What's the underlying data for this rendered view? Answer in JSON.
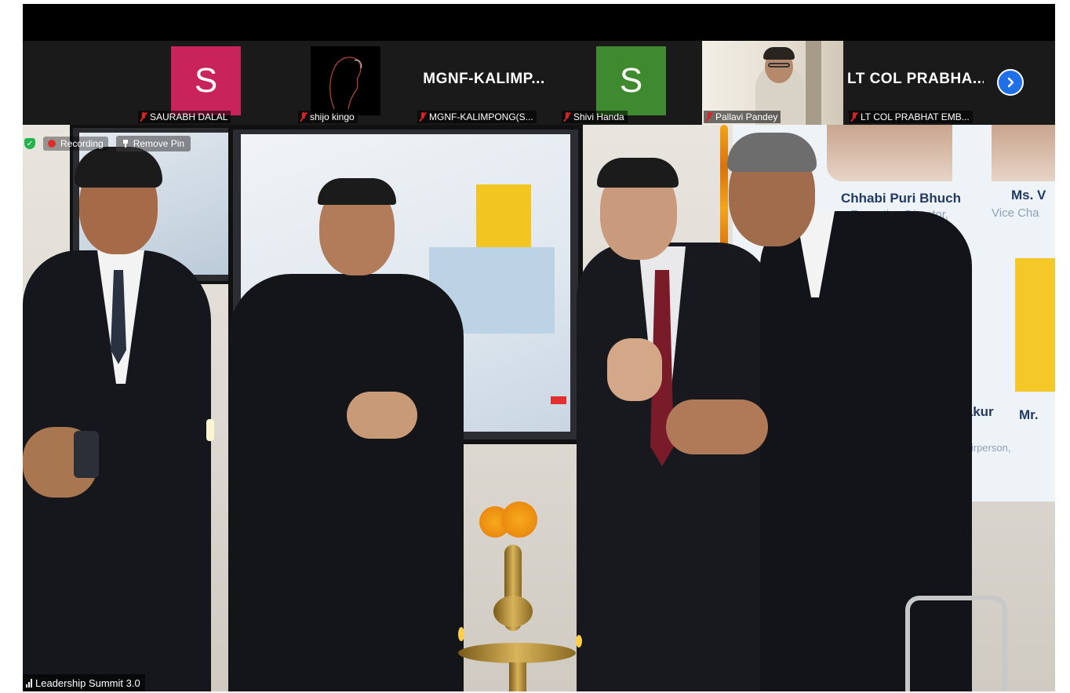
{
  "participants": [
    {
      "type": "avatar",
      "initial": "S",
      "color": "#c8235a",
      "name": "SAURABH DALAL"
    },
    {
      "type": "video",
      "name": "shijo kingo"
    },
    {
      "type": "text",
      "title": "MGNF-KALIMP...",
      "name": "MGNF-KALIMPONG(S..."
    },
    {
      "type": "avatar",
      "initial": "S",
      "color": "#3f8a2e",
      "name": "Shivi Handa"
    },
    {
      "type": "video",
      "name": "Pallavi Pandey"
    },
    {
      "type": "text",
      "title": "LT COL PRABHA...",
      "name": "LT COL PRABHAT EMB..."
    }
  ],
  "overlay": {
    "recording_label": "Recording",
    "remove_pin_label": "Remove Pin",
    "speaker_name": "Leadership Summit 3.0"
  },
  "banner": {
    "name_1": "Chhabi Puri Bhuch",
    "title_1": "Executive Director,",
    "name_2": "Ms. V",
    "title_2": "Vice Cha",
    "name_3": "Thakur",
    "name_4": "Mr. ",
    "sub_3": "Chairperson,"
  }
}
